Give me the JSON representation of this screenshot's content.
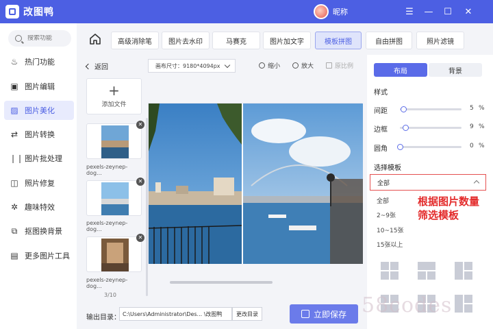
{
  "app": {
    "title": "改图鸭",
    "user_nickname": "昵称"
  },
  "window_controls": [
    "☰",
    "—",
    "☐",
    "✕"
  ],
  "sidebar": {
    "search_placeholder": "搜索功能",
    "items": [
      {
        "label": "热门功能",
        "icon": "fire-icon"
      },
      {
        "label": "图片编辑",
        "icon": "image-edit-icon"
      },
      {
        "label": "图片美化",
        "icon": "image-beautify-icon",
        "active": true
      },
      {
        "label": "图片转换",
        "icon": "convert-icon"
      },
      {
        "label": "图片批处理",
        "icon": "batch-icon"
      },
      {
        "label": "照片修复",
        "icon": "photo-repair-icon"
      },
      {
        "label": "趣味特效",
        "icon": "effects-icon"
      },
      {
        "label": "抠图换背景",
        "icon": "cutout-icon"
      },
      {
        "label": "更多图片工具",
        "icon": "toolbox-icon"
      }
    ]
  },
  "tabs": [
    "高级消除笔",
    "图片去水印",
    "马赛克",
    "图片加文字",
    "模板拼图",
    "自由拼图",
    "照片滤镜"
  ],
  "active_tab": "模板拼图",
  "file_panel": {
    "back_label": "返回",
    "add_file_label": "添加文件",
    "files": [
      {
        "name": "pexels-zeynep-dog..."
      },
      {
        "name": "pexels-zeynep-dog..."
      },
      {
        "name": "pexels-zeynep-dog..."
      }
    ],
    "count": "3/10"
  },
  "canvas_toolbar": {
    "size_label": "画布尺寸：9180*4094px",
    "zoom_out": "缩小",
    "zoom_in": "放大",
    "reset": "原比例"
  },
  "output": {
    "label": "输出目录：",
    "path": "C:\\Users\\Administrator\\Des... \\改图鸭",
    "change_dir": "更改目录",
    "save": "立即保存"
  },
  "settings": {
    "tab_layout": "布局",
    "tab_background": "背景",
    "style_heading": "样式",
    "sliders": [
      {
        "label": "间距",
        "value": "5",
        "unit": "%",
        "fraction": 0.05
      },
      {
        "label": "边框",
        "value": "9",
        "unit": "%",
        "fraction": 0.09
      },
      {
        "label": "圆角",
        "value": "0",
        "unit": "%",
        "fraction": 0.0
      }
    ],
    "template_heading": "选择模板",
    "template_selected": "全部",
    "template_options": [
      "全部",
      "2~9张",
      "10~15张",
      "15张以上"
    ],
    "annotation_line1": "根据图片数量",
    "annotation_line2": "筛选模板"
  },
  "watermark": "58codes",
  "colors": {
    "primary": "#4c5fe3",
    "button": "#6b7bea",
    "annotation": "#e32b2b",
    "highlight_border": "#e55050"
  }
}
